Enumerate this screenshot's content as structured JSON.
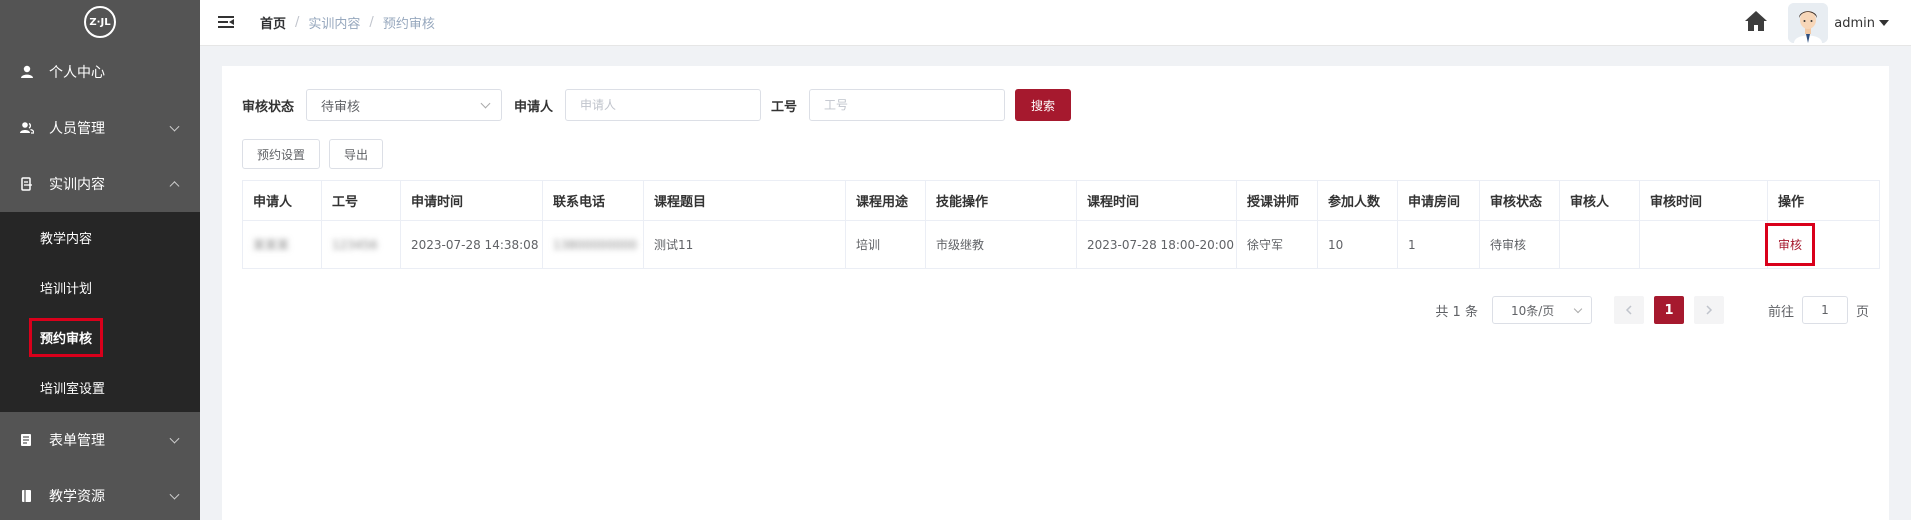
{
  "sidebar": {
    "logo_text": "Z·JL",
    "items": [
      {
        "label": "个人中心",
        "icon": "user-icon"
      },
      {
        "label": "人员管理",
        "icon": "users-icon"
      },
      {
        "label": "实训内容",
        "icon": "content-icon"
      },
      {
        "label": "表单管理",
        "icon": "form-icon"
      },
      {
        "label": "教学资源",
        "icon": "resource-icon"
      }
    ],
    "submenu": [
      {
        "label": "教学内容"
      },
      {
        "label": "培训计划"
      },
      {
        "label": "预约审核"
      },
      {
        "label": "培训室设置"
      }
    ]
  },
  "header": {
    "breadcrumb": [
      "首页",
      "实训内容",
      "预约审核"
    ],
    "breadcrumb_sep": "/",
    "username": "admin"
  },
  "filters": {
    "status_label": "审核状态",
    "status_value": "待审核",
    "applicant_label": "申请人",
    "applicant_placeholder": "申请人",
    "jobno_label": "工号",
    "jobno_placeholder": "工号",
    "search_label": "搜索"
  },
  "actions": {
    "settings_label": "预约设置",
    "export_label": "导出"
  },
  "table": {
    "columns": [
      "申请人",
      "工号",
      "申请时间",
      "联系电话",
      "课程题目",
      "课程用途",
      "技能操作",
      "课程时间",
      "授课讲师",
      "参加人数",
      "申请房间",
      "审核状态",
      "审核人",
      "审核时间",
      "操作"
    ],
    "rows": [
      {
        "applicant": "某某某",
        "jobno": "123456",
        "apply_time": "2023-07-28 14:38:08",
        "phone": "13800000000",
        "course_title": "测试11",
        "course_use": "培训",
        "skill": "市级继教",
        "course_time": "2023-07-28 18:00-20:00",
        "teacher": "徐守军",
        "participants": "10",
        "room": "1",
        "status": "待审核",
        "auditor": "",
        "audit_time": "",
        "action": "审核"
      }
    ]
  },
  "pagination": {
    "total": "共 1 条",
    "page_size": "10条/页",
    "current": "1",
    "goto_label": "前往",
    "goto_value": "1",
    "page_suffix": "页"
  },
  "colors": {
    "accent": "#a6192e",
    "sidebar": "#545454",
    "submenu": "#262626",
    "highlight": "#d9001b"
  }
}
